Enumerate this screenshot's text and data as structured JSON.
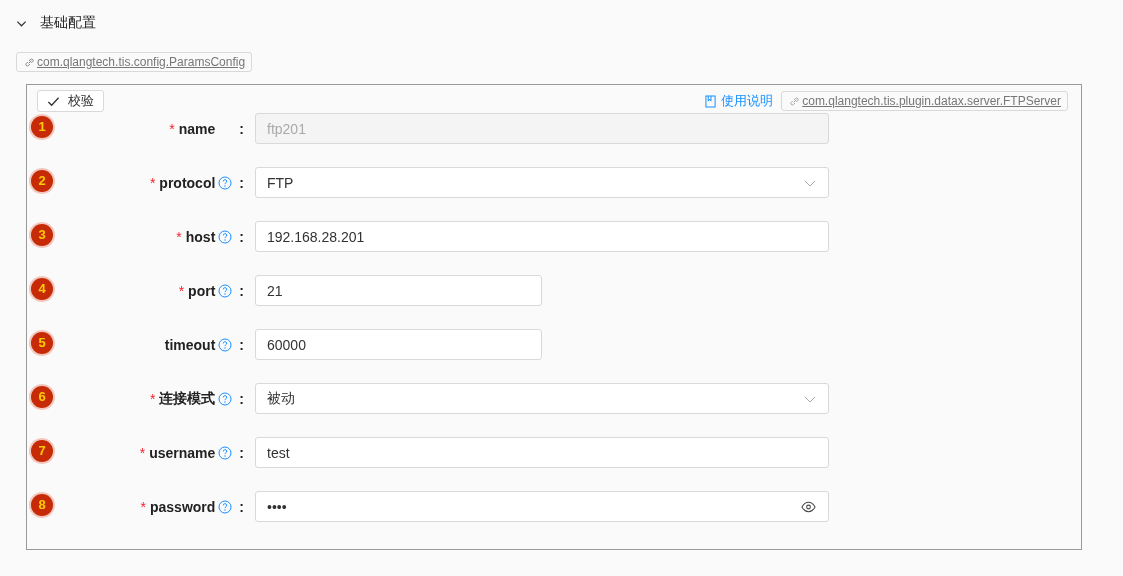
{
  "section": {
    "title": "基础配置",
    "expanded": true,
    "class_link": "com.qlangtech.tis.config.ParamsConfig"
  },
  "panel": {
    "verify_button": "校验",
    "doc_link": "使用说明",
    "plugin_link": "com.qlangtech.tis.plugin.datax.server.FTPServer"
  },
  "fields": [
    {
      "badge": "1",
      "required_mark": "*",
      "label": "name",
      "help": false,
      "colon": ":",
      "kind": "text",
      "value": "ftp201",
      "disabled": true,
      "compact": false
    },
    {
      "badge": "2",
      "required_mark": "*",
      "label": "protocol",
      "help": true,
      "colon": ":",
      "kind": "select",
      "value": "FTP",
      "disabled": false,
      "compact": false
    },
    {
      "badge": "3",
      "required_mark": "*",
      "label": "host",
      "help": true,
      "colon": ":",
      "kind": "text",
      "value": "192.168.28.201",
      "disabled": false,
      "compact": false
    },
    {
      "badge": "4",
      "required_mark": "*",
      "label": "port",
      "help": true,
      "colon": ":",
      "kind": "text",
      "value": "21",
      "disabled": false,
      "compact": true
    },
    {
      "badge": "5",
      "label": "timeout",
      "help": true,
      "colon": ":",
      "kind": "text",
      "value": "60000",
      "disabled": false,
      "compact": true
    },
    {
      "badge": "6",
      "required_mark": "*",
      "label": "连接模式",
      "help": true,
      "colon": ":",
      "kind": "select",
      "value": "被动",
      "disabled": false,
      "compact": false
    },
    {
      "badge": "7",
      "required_mark": "*",
      "label": "username",
      "help": true,
      "colon": ":",
      "kind": "text",
      "value": "test",
      "disabled": false,
      "compact": false
    },
    {
      "badge": "8",
      "required_mark": "*",
      "label": "password",
      "help": true,
      "colon": ":",
      "kind": "password",
      "value": "••••",
      "disabled": false,
      "compact": false
    }
  ]
}
